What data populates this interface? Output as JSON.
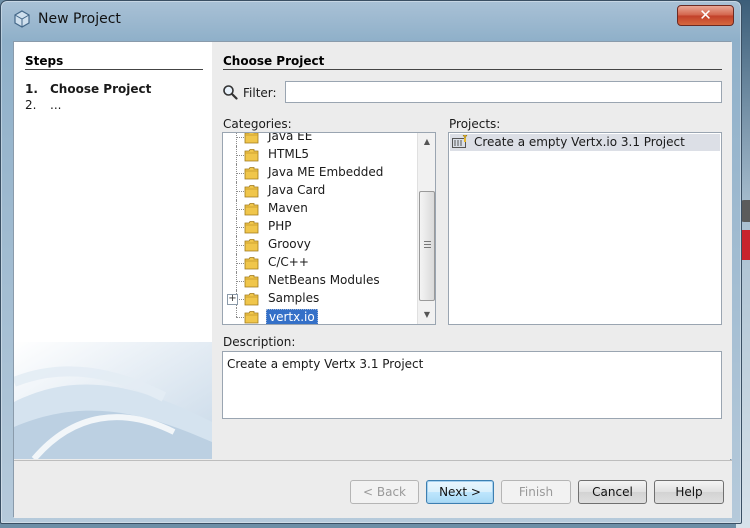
{
  "window": {
    "title": "New Project",
    "close_symbol": "✕"
  },
  "steps": {
    "title": "Steps",
    "items": [
      {
        "num": "1.",
        "label": "Choose Project"
      },
      {
        "num": "2.",
        "label": "..."
      }
    ]
  },
  "main": {
    "title": "Choose Project",
    "filter": {
      "label": "Filter:",
      "value": "",
      "placeholder": ""
    },
    "categories_label": "Categories:",
    "categories": [
      {
        "label": "Java EE"
      },
      {
        "label": "HTML5"
      },
      {
        "label": "Java ME Embedded"
      },
      {
        "label": "Java Card"
      },
      {
        "label": "Maven"
      },
      {
        "label": "PHP"
      },
      {
        "label": "Groovy"
      },
      {
        "label": "C/C++"
      },
      {
        "label": "NetBeans Modules"
      },
      {
        "label": "Samples",
        "expander": "+"
      },
      {
        "label": "vertx.io",
        "selected": true
      }
    ],
    "projects_label": "Projects:",
    "projects": [
      {
        "label": "Create a empty Vertx.io 3.1 Project",
        "selected": true
      }
    ],
    "description_label": "Description:",
    "description": "Create a empty Vertx 3.1 Project"
  },
  "buttons": {
    "back": "< Back",
    "next": "Next >",
    "finish": "Finish",
    "cancel": "Cancel",
    "help": "Help"
  },
  "icons": {
    "window": "netbeans-cube-icon",
    "filter": "magnifier-icon",
    "folder": "folder-icon",
    "project": "project-icon"
  },
  "colors": {
    "selection": "#3470c8",
    "project_selection": "#dcdfe6",
    "close_button": "#c2402a"
  }
}
